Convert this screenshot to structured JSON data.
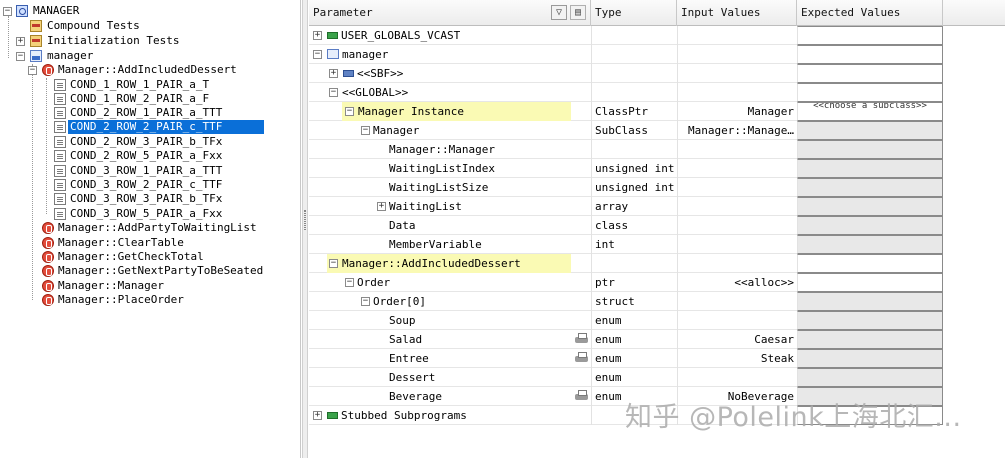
{
  "tree": {
    "root": "MANAGER",
    "compound_tests": "Compound Tests",
    "init_tests": "Initialization Tests",
    "unit": "manager",
    "function": "Manager::AddIncludedDessert",
    "test_cases": [
      "COND_1_ROW_1_PAIR_a_T",
      "COND_1_ROW_2_PAIR_a_F",
      "COND_2_ROW_1_PAIR_a_TTT",
      "COND_2_ROW_2_PAIR_c_TTF",
      "COND_2_ROW_3_PAIR_b_TFx",
      "COND_2_ROW_5_PAIR_a_Fxx",
      "COND_3_ROW_1_PAIR_a_TTT",
      "COND_3_ROW_2_PAIR_c_TTF",
      "COND_3_ROW_3_PAIR_b_TFx",
      "COND_3_ROW_5_PAIR_a_Fxx"
    ],
    "selected_test": "COND_2_ROW_2_PAIR_c_TTF",
    "other_functions": [
      "Manager::AddPartyToWaitingList",
      "Manager::ClearTable",
      "Manager::GetCheckTotal",
      "Manager::GetNextPartyToBeSeated",
      "Manager::Manager",
      "Manager::PlaceOrder"
    ]
  },
  "grid": {
    "headers": {
      "parameter": "Parameter",
      "filter_icon": "filter-icon",
      "type": "Type",
      "input": "Input Values",
      "expected": "Expected Values"
    },
    "rows": [
      {
        "name": "USER_GLOBALS_VCAST",
        "type": "",
        "input": "",
        "expected": ""
      },
      {
        "name": "manager",
        "type": "",
        "input": "",
        "expected": ""
      },
      {
        "name": "<<SBF>>",
        "type": "",
        "input": "",
        "expected": ""
      },
      {
        "name": "<<GLOBAL>>",
        "type": "",
        "input": "",
        "expected": ""
      },
      {
        "name": "Manager Instance",
        "type": "ClassPtr",
        "input": "Manager",
        "expected": "<<choose a subclass>>"
      },
      {
        "name": "Manager",
        "type": "SubClass",
        "input": "Manager::Manage…",
        "expected": ""
      },
      {
        "name": "Manager::Manager",
        "type": "",
        "input": "",
        "expected": ""
      },
      {
        "name": "WaitingListIndex",
        "type": "unsigned int",
        "input": "",
        "expected": ""
      },
      {
        "name": "WaitingListSize",
        "type": "unsigned int",
        "input": "",
        "expected": ""
      },
      {
        "name": "WaitingList",
        "type": "array",
        "input": "",
        "expected": ""
      },
      {
        "name": "Data",
        "type": "class",
        "input": "",
        "expected": ""
      },
      {
        "name": "MemberVariable",
        "type": "int",
        "input": "",
        "expected": ""
      },
      {
        "name": "Manager::AddIncludedDessert",
        "type": "",
        "input": "",
        "expected": ""
      },
      {
        "name": "Order",
        "type": "ptr",
        "input": "<<alloc>>",
        "expected": ""
      },
      {
        "name": "Order[0]",
        "type": "struct",
        "input": "",
        "expected": ""
      },
      {
        "name": "Soup",
        "type": "enum",
        "input": "",
        "expected": ""
      },
      {
        "name": "Salad",
        "type": "enum",
        "input": "Caesar",
        "expected": ""
      },
      {
        "name": "Entree",
        "type": "enum",
        "input": "Steak",
        "expected": ""
      },
      {
        "name": "Dessert",
        "type": "enum",
        "input": "",
        "expected": ""
      },
      {
        "name": "Beverage",
        "type": "enum",
        "input": "NoBeverage",
        "expected": ""
      },
      {
        "name": "Stubbed Subprograms",
        "type": "",
        "input": "",
        "expected": ""
      }
    ]
  },
  "watermark": "知乎 @Polelink上海北汇..."
}
